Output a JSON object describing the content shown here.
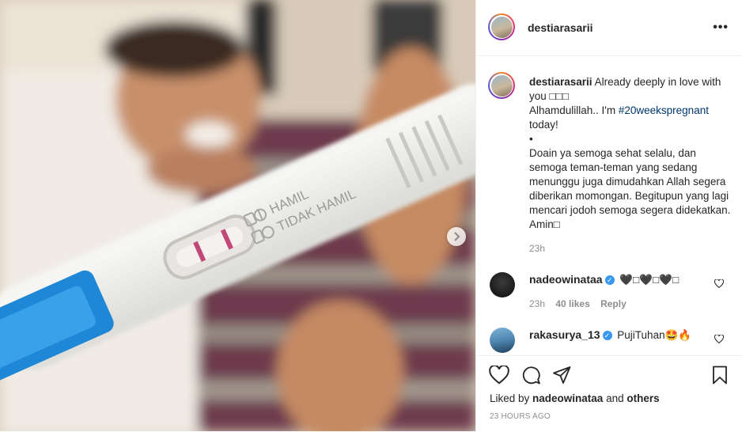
{
  "post": {
    "username": "destiarasarii",
    "caption_first": "Already deeply in love with you □□□",
    "caption_line2_pre": "Alhamdulillah.. I'm ",
    "caption_hashtag": "#20weekspregnant",
    "caption_line3": "today!",
    "caption_bullet": "•",
    "caption_paragraph": "Doain ya semoga sehat selalu, dan semoga teman-teman yang sedang menunggu juga dimudahkan Allah segera diberikan momongan. Begitupun yang lagi mencari jodoh semoga segera didekatkan. Amin□",
    "caption_time": "23h",
    "test_labels": {
      "positive": "HAMIL",
      "negative": "TIDAK HAMIL"
    }
  },
  "comments": [
    {
      "username": "nadeowinataa",
      "verified": true,
      "text": "🖤□🖤□🖤□",
      "time": "23h",
      "likes": "40 likes",
      "reply": "Reply"
    },
    {
      "username": "rakasurya_13",
      "verified": true,
      "text": "PujiTuhan🤩🔥"
    }
  ],
  "footer": {
    "liked_by_prefix": "Liked by ",
    "liked_by_user": "nadeowinataa",
    "liked_by_and": " and ",
    "liked_by_others": "others",
    "time_ago": "23 HOURS AGO"
  },
  "colors": {
    "link": "#00376b",
    "verified": "#3897f0",
    "test_blue": "#1e88d6"
  }
}
